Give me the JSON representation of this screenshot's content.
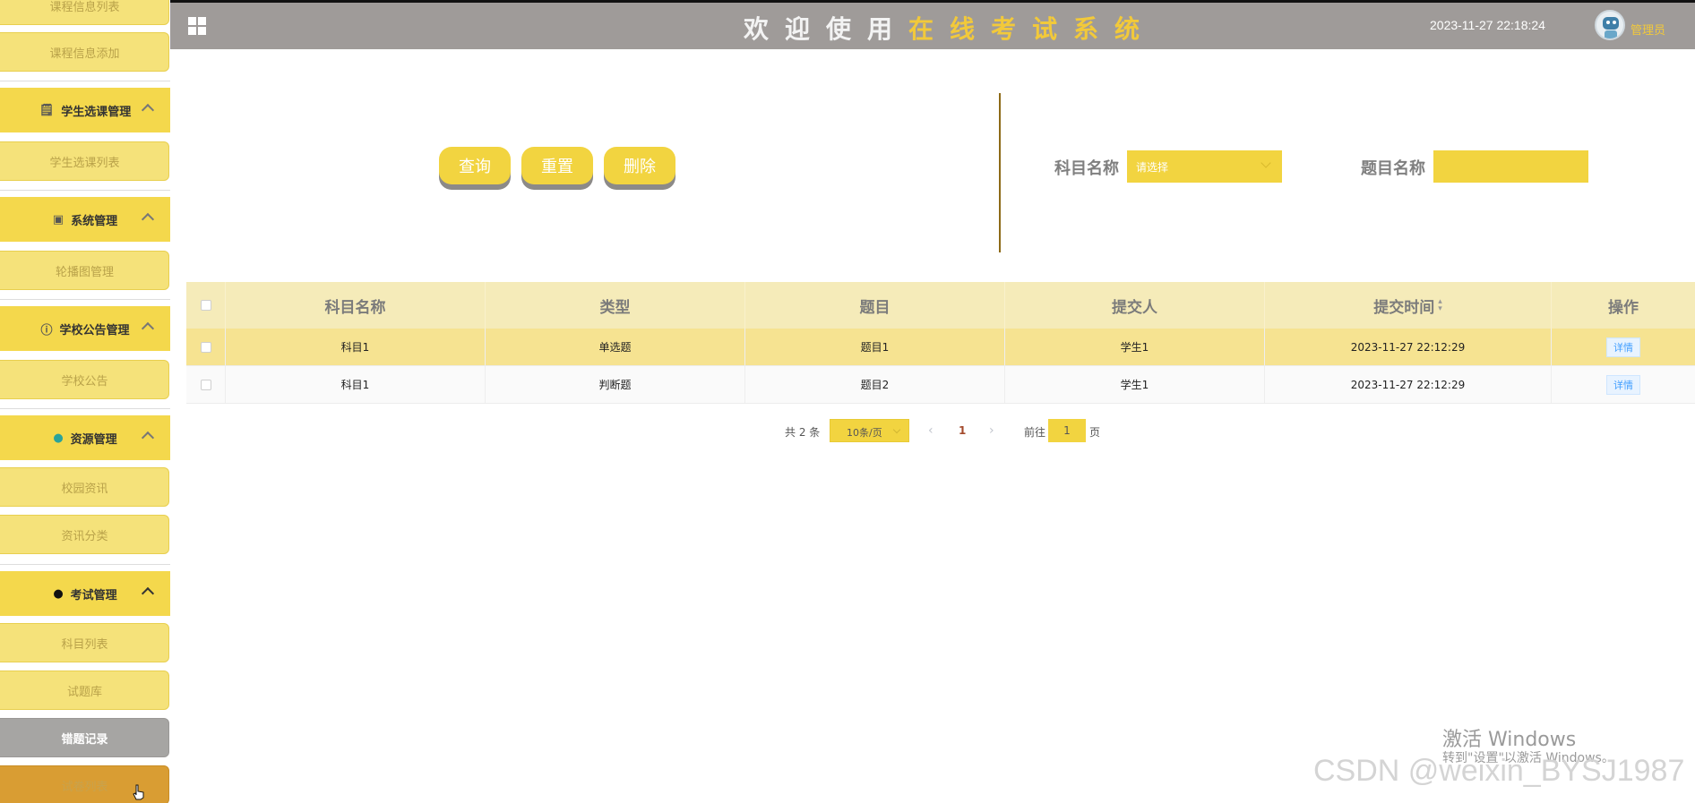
{
  "header": {
    "title_white": "欢迎使用",
    "title_yellow": "在线考试系统",
    "datetime": "2023-11-27 22:18:24",
    "user_label": "管理员"
  },
  "sidebar": {
    "items": [
      {
        "label": "课程信息列表",
        "type": "item"
      },
      {
        "label": "课程信息添加",
        "type": "item"
      },
      {
        "label": "学生选课管理",
        "type": "header",
        "icon": "note-icon"
      },
      {
        "label": "学生选课列表",
        "type": "item"
      },
      {
        "label": "系统管理",
        "type": "header",
        "icon": "image-icon"
      },
      {
        "label": "轮播图管理",
        "type": "item"
      },
      {
        "label": "学校公告管理",
        "type": "header",
        "icon": "info-icon"
      },
      {
        "label": "学校公告",
        "type": "item"
      },
      {
        "label": "资源管理",
        "type": "header",
        "icon": "pin-icon"
      },
      {
        "label": "校园资讯",
        "type": "item"
      },
      {
        "label": "资讯分类",
        "type": "item"
      },
      {
        "label": "考试管理",
        "type": "header",
        "icon": "pin-icon"
      },
      {
        "label": "科目列表",
        "type": "item"
      },
      {
        "label": "试题库",
        "type": "item"
      },
      {
        "label": "错题记录",
        "type": "item",
        "state": "active"
      },
      {
        "label": "试卷列表",
        "type": "item",
        "state": "hover"
      }
    ]
  },
  "search": {
    "buttons": {
      "query": "查询",
      "reset": "重置",
      "delete": "删除"
    },
    "subject_label": "科目名称",
    "subject_placeholder": "请选择",
    "question_label": "题目名称",
    "question_value": ""
  },
  "table": {
    "columns": [
      "科目名称",
      "类型",
      "题目",
      "提交人",
      "提交时间",
      "操作"
    ],
    "rows": [
      {
        "subject": "科目1",
        "type": "单选题",
        "question": "题目1",
        "submitter": "学生1",
        "time": "2023-11-27 22:12:29",
        "action": "详情"
      },
      {
        "subject": "科目1",
        "type": "判断题",
        "question": "题目2",
        "submitter": "学生1",
        "time": "2023-11-27 22:12:29",
        "action": "详情"
      }
    ]
  },
  "pagination": {
    "total": "共 2 条",
    "page_size": "10条/页",
    "current_page": "1",
    "goto_label": "前往",
    "goto_value": "1",
    "page_suffix": "页"
  },
  "watermark": {
    "windows_title": "激活 Windows",
    "windows_sub": "转到\"设置\"以激活 Windows。",
    "csdn": "CSDN @weixin_BYSJ1987"
  },
  "colors": {
    "accent_yellow": "#f2d440",
    "header_gray": "#9f9b99",
    "title_yellow": "#f2c93a"
  }
}
